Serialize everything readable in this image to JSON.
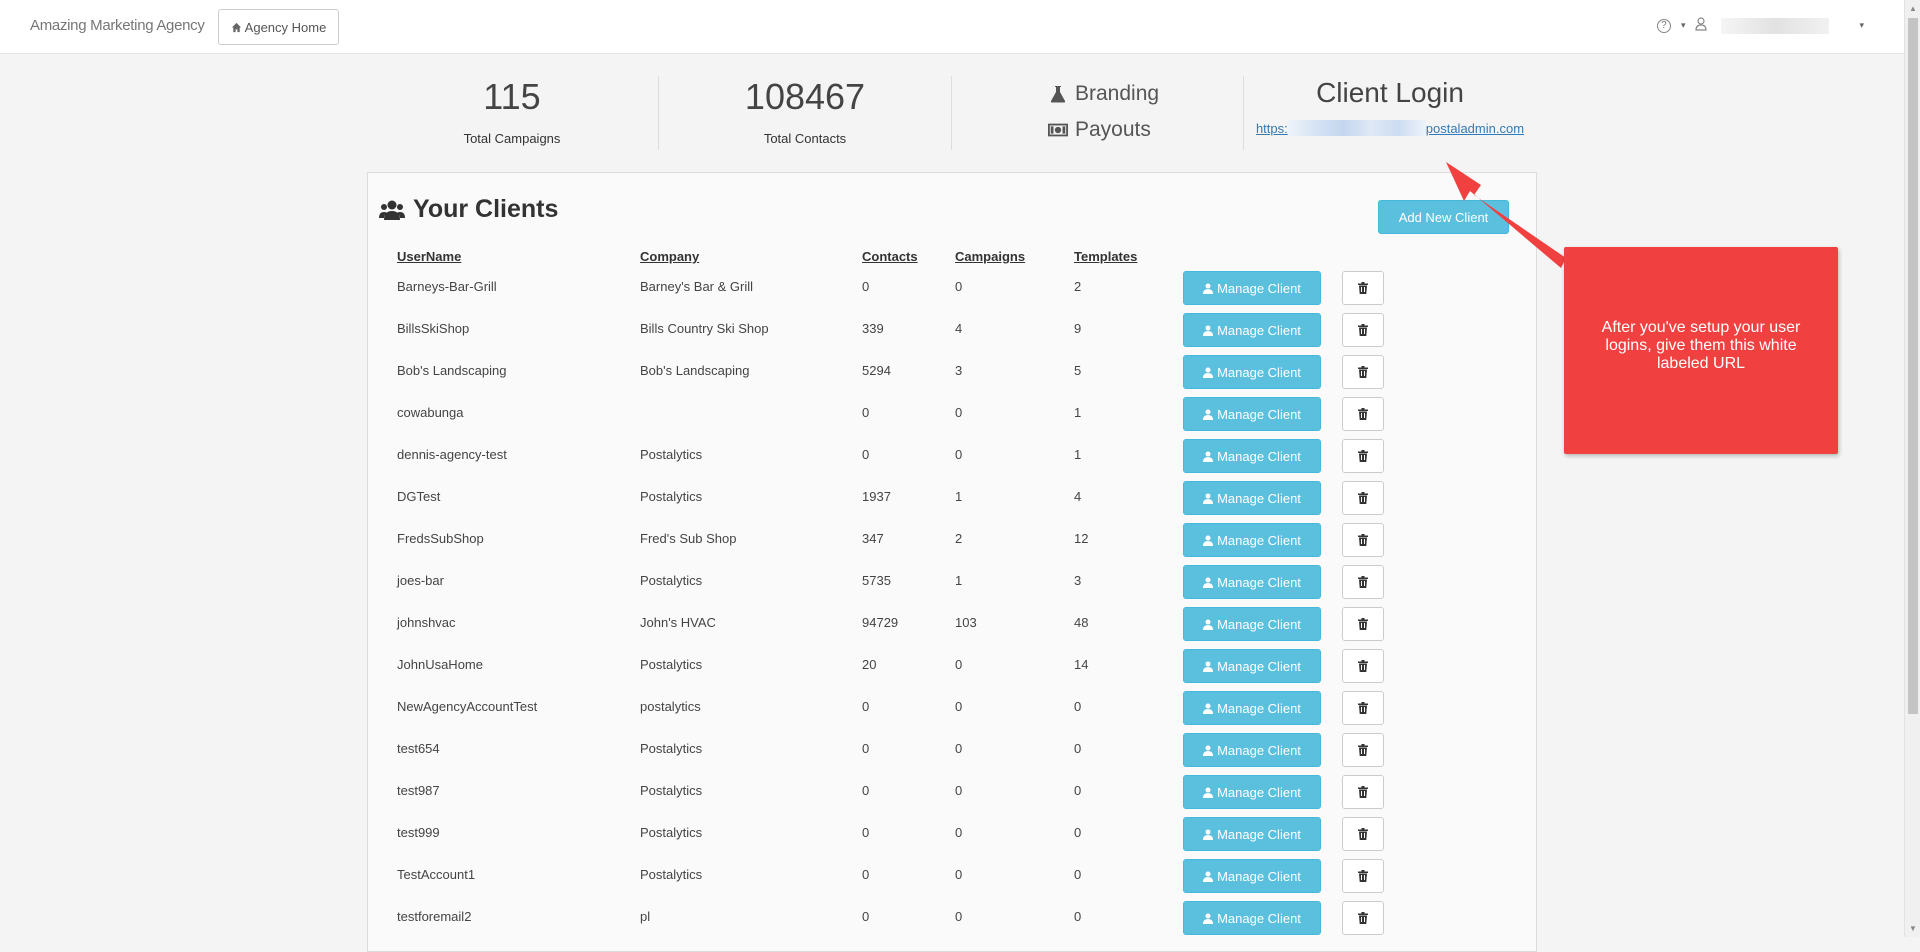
{
  "navbar": {
    "brand": "Amazing Marketing Agency",
    "home_button": "Agency Home",
    "help_icon": "?",
    "caret": "▾"
  },
  "stats": {
    "campaigns_value": "115",
    "campaigns_label": "Total Campaigns",
    "contacts_value": "108467",
    "contacts_label": "Total Contacts"
  },
  "links": {
    "branding": "Branding",
    "payouts": "Payouts"
  },
  "client_login": {
    "title": "Client Login",
    "url_prefix": "https:",
    "url_suffix": "postaladmin.com"
  },
  "clients": {
    "title": "Your Clients",
    "add_button": "Add New Client",
    "manage_label": "Manage Client",
    "headers": {
      "username": "UserName",
      "company": "Company",
      "contacts": "Contacts",
      "campaigns": "Campaigns",
      "templates": "Templates"
    },
    "rows": [
      {
        "username": "Barneys-Bar-Grill",
        "company": "Barney's Bar & Grill",
        "contacts": "0",
        "campaigns": "0",
        "templates": "2"
      },
      {
        "username": "BillsSkiShop",
        "company": "Bills Country Ski Shop",
        "contacts": "339",
        "campaigns": "4",
        "templates": "9"
      },
      {
        "username": "Bob's Landscaping",
        "company": "Bob's Landscaping",
        "contacts": "5294",
        "campaigns": "3",
        "templates": "5"
      },
      {
        "username": "cowabunga",
        "company": "",
        "contacts": "0",
        "campaigns": "0",
        "templates": "1"
      },
      {
        "username": "dennis-agency-test",
        "company": "Postalytics",
        "contacts": "0",
        "campaigns": "0",
        "templates": "1"
      },
      {
        "username": "DGTest",
        "company": "Postalytics",
        "contacts": "1937",
        "campaigns": "1",
        "templates": "4"
      },
      {
        "username": "FredsSubShop",
        "company": "Fred's Sub Shop",
        "contacts": "347",
        "campaigns": "2",
        "templates": "12"
      },
      {
        "username": "joes-bar",
        "company": "Postalytics",
        "contacts": "5735",
        "campaigns": "1",
        "templates": "3"
      },
      {
        "username": "johnshvac",
        "company": "John's HVAC",
        "contacts": "94729",
        "campaigns": "103",
        "templates": "48"
      },
      {
        "username": "JohnUsaHome",
        "company": "Postalytics",
        "contacts": "20",
        "campaigns": "0",
        "templates": "14"
      },
      {
        "username": "NewAgencyAccountTest",
        "company": "postalytics",
        "contacts": "0",
        "campaigns": "0",
        "templates": "0"
      },
      {
        "username": "test654",
        "company": "Postalytics",
        "contacts": "0",
        "campaigns": "0",
        "templates": "0"
      },
      {
        "username": "test987",
        "company": "Postalytics",
        "contacts": "0",
        "campaigns": "0",
        "templates": "0"
      },
      {
        "username": "test999",
        "company": "Postalytics",
        "contacts": "0",
        "campaigns": "0",
        "templates": "0"
      },
      {
        "username": "TestAccount1",
        "company": "Postalytics",
        "contacts": "0",
        "campaigns": "0",
        "templates": "0"
      },
      {
        "username": "testforemail2",
        "company": "pl",
        "contacts": "0",
        "campaigns": "0",
        "templates": "0"
      }
    ]
  },
  "annotation": {
    "text": "After you've setup your user logins, give them this white labeled URL"
  },
  "colors": {
    "info_button": "#5bc0de",
    "link": "#337ab7",
    "callout": "#f04040"
  },
  "icons": {
    "home": "home-icon",
    "help": "question-circle-icon",
    "user": "user-icon",
    "flask": "flask-icon",
    "money": "money-icon",
    "users": "users-icon",
    "trash": "trash-icon"
  }
}
